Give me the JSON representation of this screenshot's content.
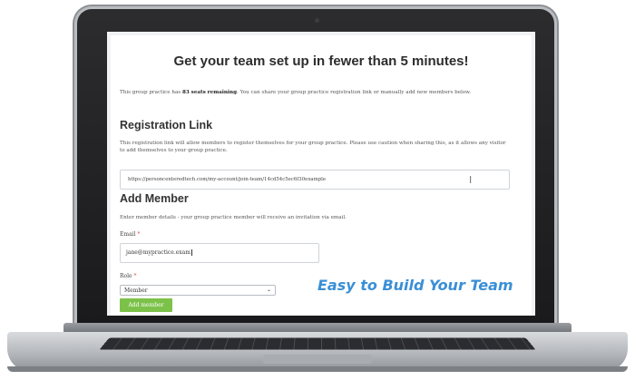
{
  "header": {
    "title": "Get your team set up in fewer than 5 minutes!"
  },
  "intro": {
    "prefix": "This group practice has ",
    "seats": "83 seats remaining",
    "suffix": ". You can share your group practice registration link or manually add new members below."
  },
  "registration": {
    "heading": "Registration Link",
    "description": "This registration link will allow members to register themselves for your group practice. Please use caution when sharing this, as it allows any visitor to add themselves to your group practice.",
    "link": "https://personcenteredtech.com/my-account/join-team/14cd54c5ec6f30example"
  },
  "add_member": {
    "heading": "Add Member",
    "description": "Enter member details - your group practice member will receive an invitation via email.",
    "email_label": "Email",
    "email_value": "jane@mypractice.exam",
    "required_mark": "*",
    "role_label": "Role",
    "role_value": "Member",
    "button_label": "Add member"
  },
  "tagline": "Easy to Build Your Team",
  "colors": {
    "button": "#7cc24a",
    "tagline": "#3a8fd6",
    "required": "#d9534f"
  },
  "icons": {
    "cursor": "text-cursor-icon",
    "dropdown": "chevron-down-icon"
  }
}
